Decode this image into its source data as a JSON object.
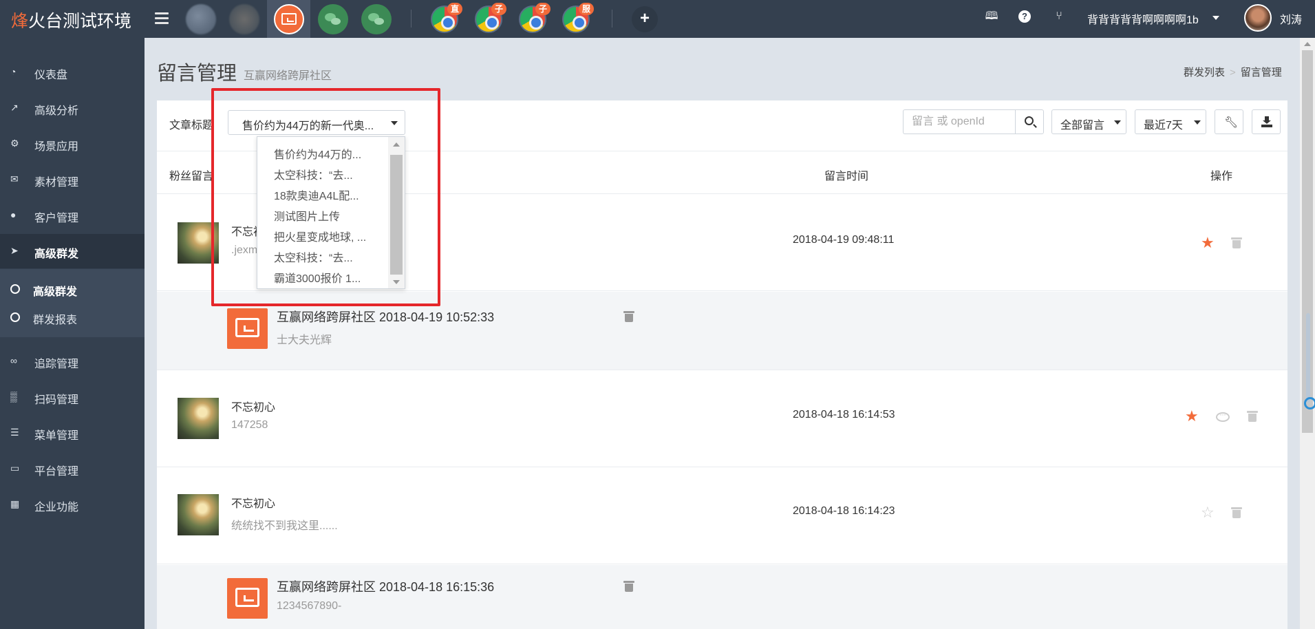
{
  "app": {
    "brand_highlight": "烽",
    "brand_rest": "火台测试环境"
  },
  "topbar": {
    "badges": [
      "直",
      "子",
      "子",
      "服"
    ],
    "username_menu": "背背背背背啊啊啊啊1b",
    "display_name": "刘涛"
  },
  "sidebar": {
    "items": [
      {
        "label": "仪表盘",
        "icon": "dashboard-icon"
      },
      {
        "label": "高级分析",
        "icon": "line-chart-icon"
      },
      {
        "label": "场景应用",
        "icon": "gear-icon"
      },
      {
        "label": "素材管理",
        "icon": "envelope-icon"
      },
      {
        "label": "客户管理",
        "icon": "user-icon"
      },
      {
        "label": "高级群发",
        "icon": "paper-plane-icon",
        "active": true
      },
      {
        "label": "追踪管理",
        "icon": "link-icon"
      },
      {
        "label": "扫码管理",
        "icon": "qrcode-icon"
      },
      {
        "label": "菜单管理",
        "icon": "list-icon"
      },
      {
        "label": "平台管理",
        "icon": "desktop-icon"
      },
      {
        "label": "企业功能",
        "icon": "grid-icon"
      }
    ],
    "subitems": [
      {
        "label": "高级群发",
        "active": true
      },
      {
        "label": "群发报表",
        "active": false
      }
    ]
  },
  "header": {
    "title": "留言管理",
    "subtitle": "互赢网络跨屏社区",
    "breadcrumb": [
      "群发列表",
      "留言管理"
    ]
  },
  "filters": {
    "article_label": "文章标题",
    "article_selected": "售价约为44万的新一代奥...",
    "search_placeholder": "留言 或 openId",
    "comment_filter": "全部留言",
    "date_range": "最近7天"
  },
  "dropdown": {
    "options": [
      "售价约为44万的...",
      "太空科技：“去...",
      "18款奥迪A4L配...",
      "测试图片上传",
      "把火星变成地球, ...",
      "太空科技：“去...",
      "霸道3000报价 1..."
    ]
  },
  "table": {
    "columns": [
      "粉丝留言",
      "留言时间",
      "操作"
    ],
    "rows": [
      {
        "type": "comment",
        "name": "不忘初心",
        "message": ".jexm",
        "time": "2018-04-19 09:48:11",
        "starred": true
      },
      {
        "type": "reply",
        "title": "互赢网络跨屏社区 2018-04-19 10:52:33",
        "message": "士大夫光辉"
      },
      {
        "type": "comment",
        "name": "不忘初心",
        "message": "147258",
        "time": "2018-04-18 16:14:53",
        "starred": true
      },
      {
        "type": "comment",
        "name": "不忘初心",
        "message": "统统找不到我这里......",
        "time": "2018-04-18 16:14:23",
        "starred": false
      },
      {
        "type": "reply",
        "title": "互赢网络跨屏社区 2018-04-18 16:15:36",
        "message": "1234567890-"
      }
    ]
  },
  "colors": {
    "topbar": "#34404f",
    "accent": "#f26b3a",
    "highlight_box": "#e5272b"
  }
}
